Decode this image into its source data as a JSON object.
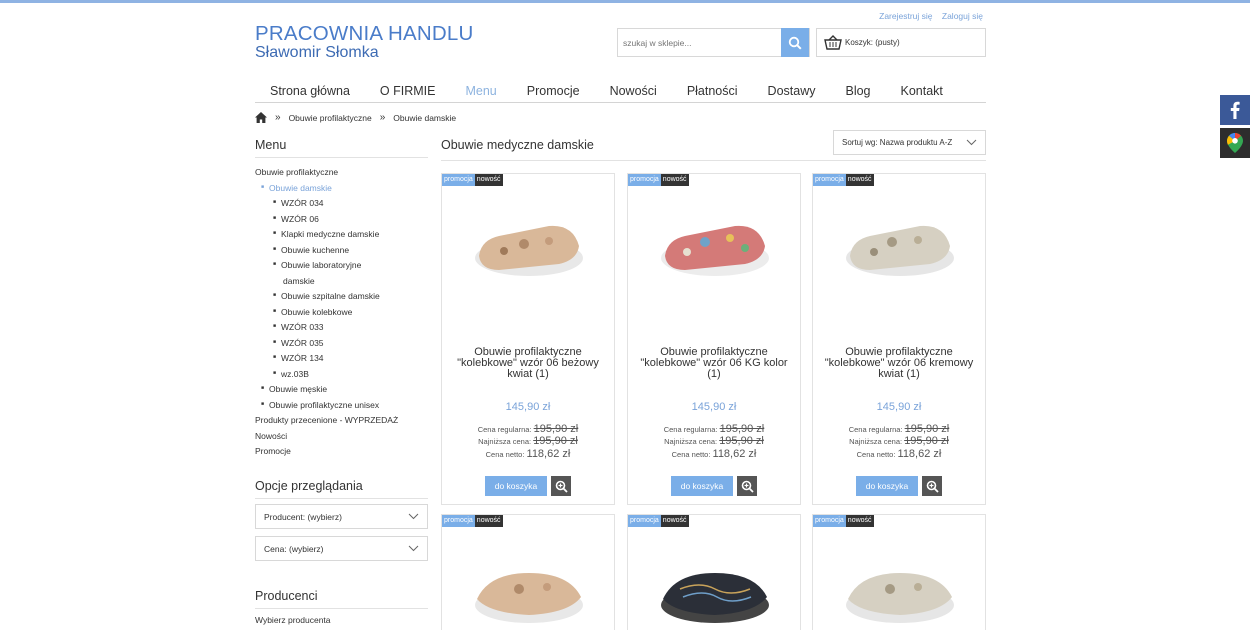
{
  "header": {
    "register": "Zarejestruj się",
    "login": "Zaloguj się",
    "logo_line1": "PRACOWNIA HANDLU",
    "logo_line2": "Sławomir Słomka",
    "search_placeholder": "szukaj w sklepie...",
    "cart_label": "Koszyk: (pusty)"
  },
  "nav": [
    "Strona główna",
    "O FIRMIE",
    "Menu",
    "Promocje",
    "Nowości",
    "Płatności",
    "Dostawy",
    "Blog",
    "Kontakt"
  ],
  "nav_active": "Menu",
  "breadcrumb": [
    "Obuwie profilaktyczne",
    "Obuwie damskie"
  ],
  "sidebar": {
    "menu_title": "Menu",
    "items": [
      {
        "label": "Obuwie profilaktyczne",
        "level": 0
      },
      {
        "label": "Obuwie damskie",
        "level": 1,
        "active": true
      },
      {
        "label": "WZÓR 034",
        "level": 2
      },
      {
        "label": "WZÓR 06",
        "level": 2
      },
      {
        "label": "Klapki medyczne damskie",
        "level": 2
      },
      {
        "label": "Obuwie kuchenne",
        "level": 2
      },
      {
        "label": "Obuwie laboratoryjne",
        "level": 2
      },
      {
        "label": "damskie",
        "level": 3
      },
      {
        "label": "Obuwie szpitalne damskie",
        "level": 2
      },
      {
        "label": "Obuwie kolebkowe",
        "level": 2
      },
      {
        "label": "WZÓR 033",
        "level": 2
      },
      {
        "label": "WZÓR 035",
        "level": 2
      },
      {
        "label": "WZÓR 134",
        "level": 2
      },
      {
        "label": "wz.03B",
        "level": 2
      },
      {
        "label": "Obuwie męskie",
        "level": 1
      },
      {
        "label": "Obuwie profilaktyczne unisex",
        "level": 1
      },
      {
        "label": "Produkty przecenione - WYPRZEDAŻ",
        "level": 0
      },
      {
        "label": "Nowości",
        "level": 0
      },
      {
        "label": "Promocje",
        "level": 0
      }
    ],
    "options_title": "Opcje przeglądania",
    "producer_select": "Producent: (wybierz)",
    "price_select": "Cena: (wybierz)",
    "producers_title": "Producenci",
    "producers_select": "Wybierz producenta"
  },
  "main": {
    "title": "Obuwie medyczne damskie",
    "sort_label": "Sortuj wg: Nazwa produktu A-Z",
    "badge_promo": "promocja",
    "badge_new": "nowość",
    "label_regular": "Cena regularna:",
    "label_lowest": "Najniższa cena:",
    "label_net": "Cena netto:",
    "add_to_cart": "do koszyka",
    "products": [
      {
        "name": "Obuwie profilaktyczne \"kolebkowe\" wzór 06 beżowy kwiat (1)",
        "price": "145,90 zł",
        "regular": "195,90 zł",
        "lowest": "195,90 zł",
        "net": "118,62 zł",
        "color": "#d9b899"
      },
      {
        "name": "Obuwie profilaktyczne \"kolebkowe\" wzór 06 KG kolor (1)",
        "price": "145,90 zł",
        "regular": "195,90 zł",
        "lowest": "195,90 zł",
        "net": "118,62 zł",
        "color": "#d47a78"
      },
      {
        "name": "Obuwie profilaktyczne \"kolebkowe\" wzór 06 kremowy kwiat (1)",
        "price": "145,90 zł",
        "regular": "195,90 zł",
        "lowest": "195,90 zł",
        "net": "118,62 zł",
        "color": "#d6d0c2"
      },
      {
        "color": "#d9b899"
      },
      {
        "color": "#2b2f38"
      },
      {
        "color": "#d6d0c2"
      }
    ]
  },
  "colors": {
    "accent": "#7aaee8",
    "brand": "#4a7cc9",
    "badge_dark": "#333333",
    "facebook": "#3b5998",
    "maps": "#2d2d2d"
  }
}
